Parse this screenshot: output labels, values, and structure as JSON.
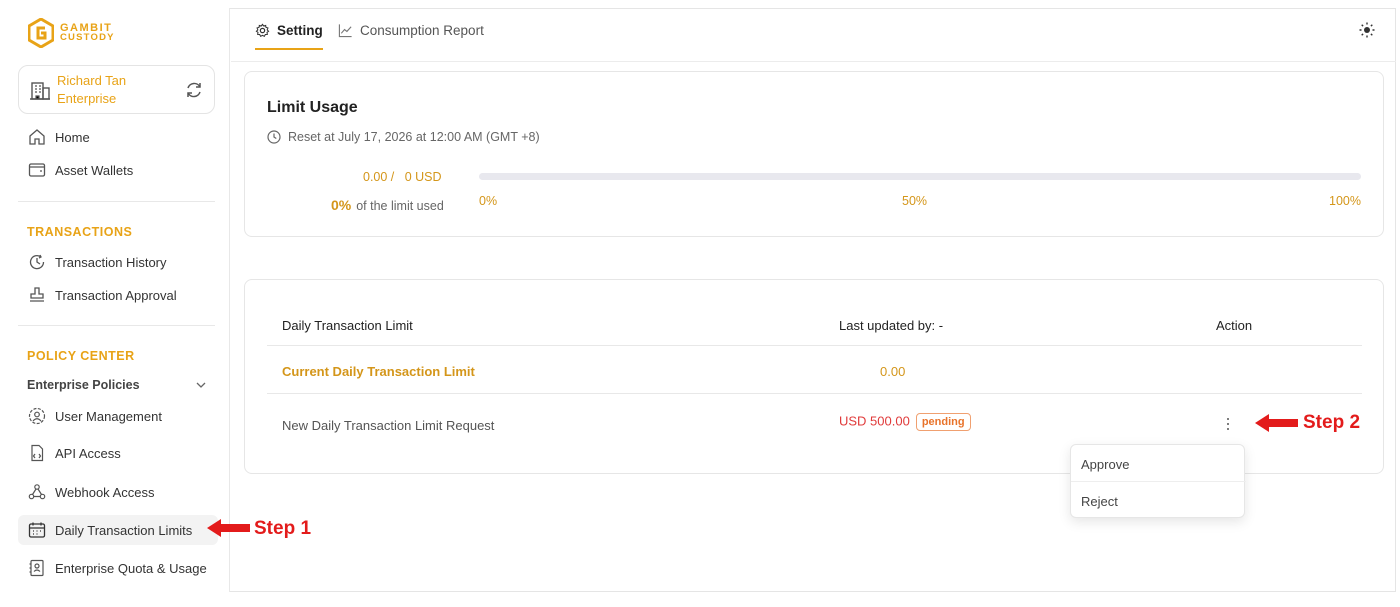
{
  "brand": {
    "line1": "GAMBIT",
    "line2": "CUSTODY",
    "color": "#e8a317"
  },
  "enterprise": {
    "name": "Richard Tan Enterprise"
  },
  "sidebar": {
    "items_top": [
      {
        "label": "Home",
        "icon": "home-icon"
      },
      {
        "label": "Asset Wallets",
        "icon": "wallet-icon"
      }
    ],
    "transactions_label": "TRANSACTIONS",
    "transactions_items": [
      {
        "label": "Transaction History",
        "icon": "history-icon"
      },
      {
        "label": "Transaction Approval",
        "icon": "stamp-icon"
      }
    ],
    "policy_label": "POLICY CENTER",
    "policy_group": "Enterprise Policies",
    "policy_items": [
      {
        "label": "User Management",
        "icon": "user-gear-icon"
      },
      {
        "label": "API Access",
        "icon": "api-icon"
      },
      {
        "label": "Webhook Access",
        "icon": "webhook-icon"
      },
      {
        "label": "Daily Transaction Limits",
        "icon": "calendar-icon",
        "active": true
      },
      {
        "label": "Enterprise Quota & Usage",
        "icon": "quota-icon"
      }
    ]
  },
  "tabs": [
    {
      "label": "Setting",
      "icon": "gear-icon",
      "active": true
    },
    {
      "label": "Consumption Report",
      "icon": "chart-icon",
      "active": false
    }
  ],
  "limit_usage": {
    "title": "Limit Usage",
    "reset_text": "Reset at July 17, 2026 at 12:00 AM (GMT +8)",
    "amount_text": "0.00 /   0 USD",
    "percent": "0%",
    "percent_suffix": "of the limit used",
    "progress_fraction": 0,
    "bar_labels": [
      "0%",
      "50%",
      "100%"
    ]
  },
  "limit_table": {
    "headers": [
      "Daily Transaction Limit",
      "Last updated by: -",
      "Action"
    ],
    "current_row": {
      "label": "Current Daily Transaction Limit",
      "value": "0.00"
    },
    "request_row": {
      "label": "New Daily Transaction Limit Request",
      "value": "USD 500.00",
      "status": "pending"
    }
  },
  "action_menu": {
    "items": [
      "Approve",
      "Reject"
    ]
  },
  "annotations": {
    "step1": "Step 1",
    "step2": "Step 2",
    "color": "#e31b1b"
  }
}
